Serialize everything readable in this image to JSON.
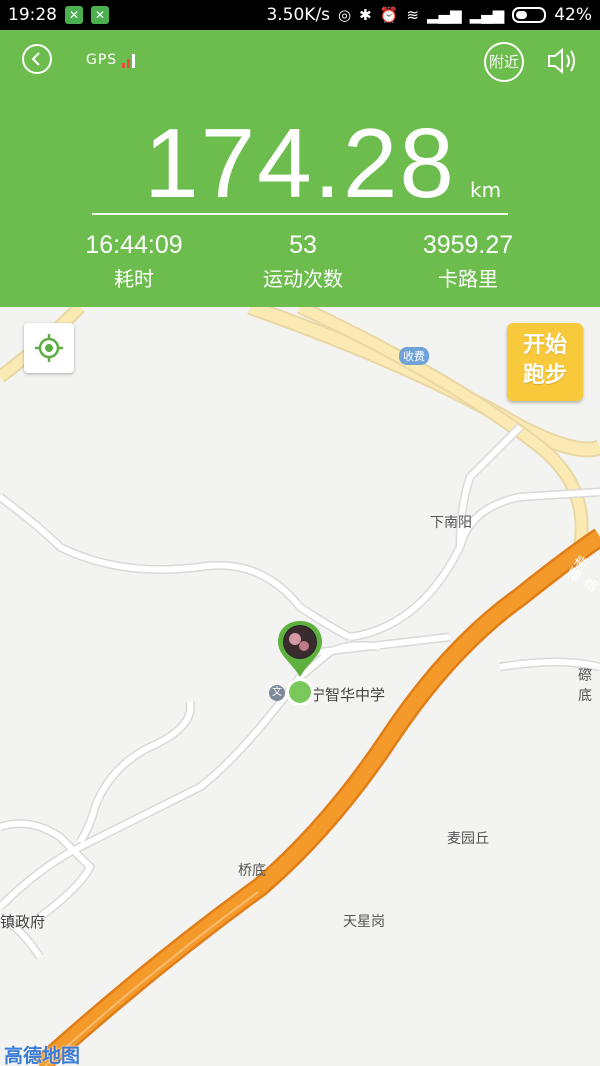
{
  "status_bar": {
    "time": "19:28",
    "speed": "3.50K/s",
    "battery": "42%",
    "battery_level": 0.42
  },
  "header": {
    "gps_label": "GPS",
    "nearby_label": "附近",
    "distance": "174.28",
    "distance_unit": "km",
    "stats": [
      {
        "value": "16:44:09",
        "label": "耗时"
      },
      {
        "value": "53",
        "label": "运动次数"
      },
      {
        "value": "3959.27",
        "label": "卡路里"
      }
    ]
  },
  "map": {
    "start_run_line1": "开始",
    "start_run_line2": "跑步",
    "toll_label": "收费",
    "highway_label": "福寿高",
    "school_icon": "文",
    "labels": {
      "xianan": "下南阳",
      "school": "宁智华中学",
      "maiyuan": "麦园丘",
      "qiaodi": "桥底",
      "zhenzhengfu": "镇政府",
      "tianxing": "天星岗",
      "edge": "磜底"
    },
    "logo": "高德地图"
  },
  "colors": {
    "header_green": "#6cbd4e",
    "highway_orange": "#f39a2a",
    "button_yellow": "#f8c93a",
    "expressway_yellow": "#fbeab4"
  }
}
